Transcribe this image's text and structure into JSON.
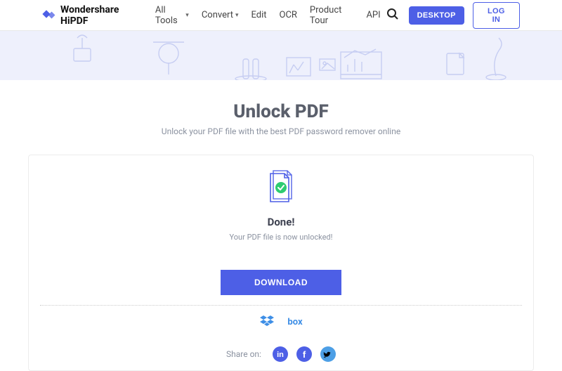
{
  "header": {
    "brand": "Wondershare HiPDF",
    "nav": {
      "all_tools": "All Tools",
      "convert": "Convert",
      "edit": "Edit",
      "ocr": "OCR",
      "product_tour": "Product Tour",
      "api": "API"
    },
    "desktop_btn": "DESKTOP",
    "login_btn": "LOG IN"
  },
  "page": {
    "title": "Unlock PDF",
    "subtitle": "Unlock your PDF file with the best PDF password remover online"
  },
  "result": {
    "done": "Done!",
    "message": "Your PDF file is now unlocked!",
    "download_btn": "DOWNLOAD"
  },
  "cloud": {
    "dropbox": "dropbox-icon",
    "box": "box"
  },
  "share": {
    "label": "Share on:"
  }
}
